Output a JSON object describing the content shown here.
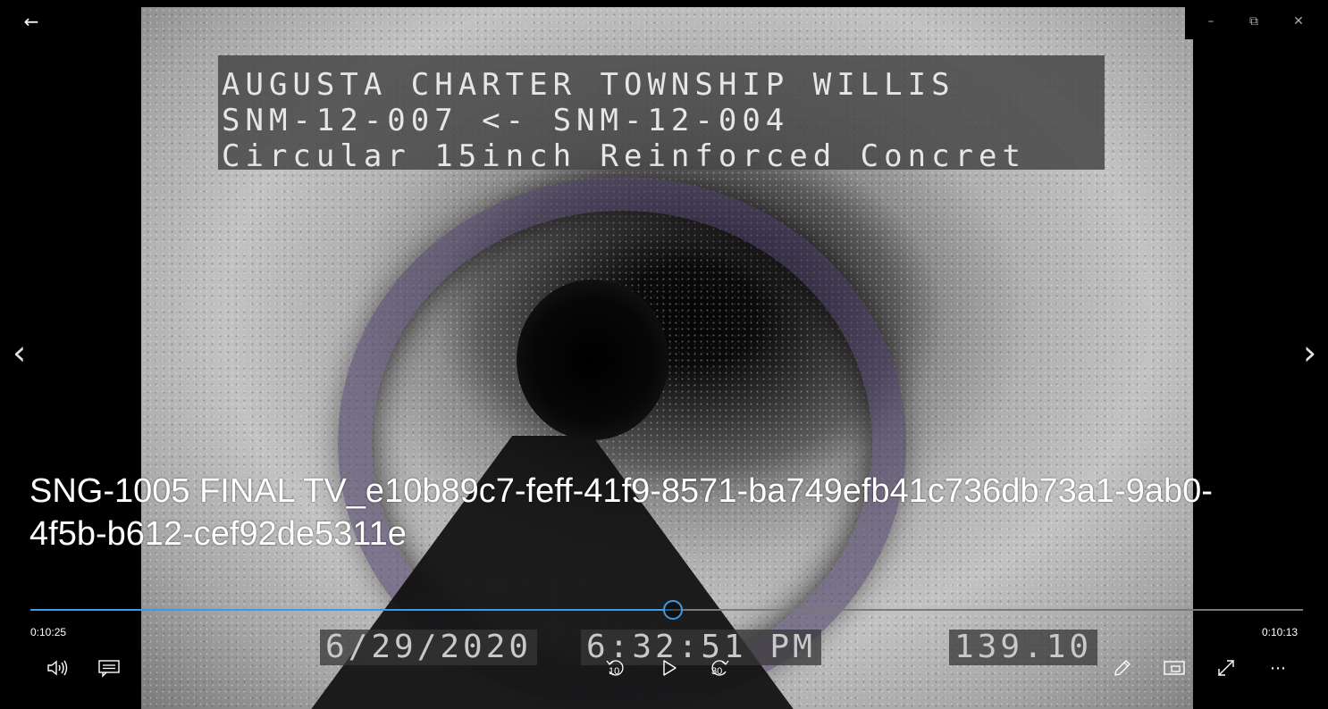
{
  "window": {
    "back_icon": "←",
    "minimize_icon": "–",
    "restore_icon": "⧉",
    "close_icon": "✕"
  },
  "video": {
    "osd": {
      "line1": "AUGUSTA CHARTER TOWNSHIP WILLIS",
      "line2": "SNM-12-007 <- SNM-12-004",
      "line3": "Circular 15inch Reinforced Concret",
      "date": "6/29/2020",
      "time": "6:32:51 PM",
      "distance": "139.10"
    }
  },
  "navigation": {
    "prev_icon": "‹",
    "next_icon": "›"
  },
  "media": {
    "title": "SNG-1005 FINAL TV_e10b89c7-feff-41f9-8571-ba749efb41c736db73a1-9ab0-4f5b-b612-cef92de5311e",
    "elapsed": "0:10:25",
    "remaining": "0:10:13",
    "progress_fraction": 0.505,
    "skip_back_label": "10",
    "skip_forward_label": "30",
    "more_icon": "⋯",
    "accent_color": "#3f9ae4"
  }
}
